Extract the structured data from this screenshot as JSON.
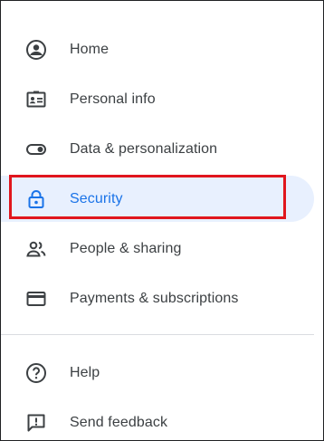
{
  "nav": {
    "items": [
      {
        "label": "Home",
        "icon": "account-circle-icon"
      },
      {
        "label": "Personal info",
        "icon": "id-card-icon"
      },
      {
        "label": "Data & personalization",
        "icon": "toggle-icon"
      },
      {
        "label": "Security",
        "icon": "lock-icon",
        "active": true
      },
      {
        "label": "People & sharing",
        "icon": "people-icon"
      },
      {
        "label": "Payments & subscriptions",
        "icon": "credit-card-icon"
      }
    ],
    "footer": [
      {
        "label": "Help",
        "icon": "help-icon"
      },
      {
        "label": "Send feedback",
        "icon": "feedback-icon"
      }
    ]
  },
  "colors": {
    "active_bg": "#e8f0fe",
    "active_text": "#1a73e8",
    "highlight_outline": "#e0161d",
    "text": "#3c4043"
  }
}
